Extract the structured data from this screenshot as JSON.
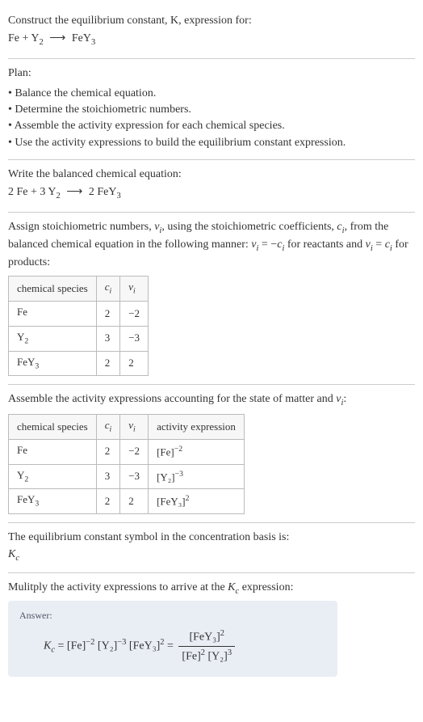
{
  "intro": {
    "line1": "Construct the equilibrium constant, K, expression for:",
    "reaction_lhs_a": "Fe",
    "plus": "+",
    "reaction_lhs_b": "Y",
    "reaction_lhs_b_sub": "2",
    "arrow": "⟶",
    "reaction_rhs": "FeY",
    "reaction_rhs_sub": "3"
  },
  "plan": {
    "heading": "Plan:",
    "items": [
      "Balance the chemical equation.",
      "Determine the stoichiometric numbers.",
      "Assemble the activity expression for each chemical species.",
      "Use the activity expressions to build the equilibrium constant expression."
    ]
  },
  "balanced": {
    "heading": "Write the balanced chemical equation:",
    "c1": "2",
    "sp1": "Fe",
    "plus1": "+",
    "c2": "3",
    "sp2": "Y",
    "sp2_sub": "2",
    "arrow": "⟶",
    "c3": "2",
    "sp3": "FeY",
    "sp3_sub": "3"
  },
  "assign": {
    "text_a": "Assign stoichiometric numbers, ",
    "nu": "ν",
    "nu_sub": "i",
    "text_b": ", using the stoichiometric coefficients, ",
    "ci": "c",
    "ci_sub": "i",
    "text_c": ", from the balanced chemical equation in the following manner: ",
    "rel1_a": "ν",
    "rel1_asub": "i",
    "rel1_eq": " = −",
    "rel1_b": "c",
    "rel1_bsub": "i",
    "text_d": " for reactants and ",
    "rel2_a": "ν",
    "rel2_asub": "i",
    "rel2_eq": " = ",
    "rel2_b": "c",
    "rel2_bsub": "i",
    "text_e": " for products:"
  },
  "table1": {
    "h1": "chemical species",
    "h2c": "c",
    "h2s": "i",
    "h3c": "ν",
    "h3s": "i",
    "rows": [
      {
        "sp": "Fe",
        "spsub": "",
        "c": "2",
        "v": "−2"
      },
      {
        "sp": "Y",
        "spsub": "2",
        "c": "3",
        "v": "−3"
      },
      {
        "sp": "FeY",
        "spsub": "3",
        "c": "2",
        "v": "2"
      }
    ]
  },
  "assemble": {
    "text_a": "Assemble the activity expressions accounting for the state of matter and ",
    "nu": "ν",
    "nu_sub": "i",
    "text_b": ":"
  },
  "table2": {
    "h1": "chemical species",
    "h2c": "c",
    "h2s": "i",
    "h3c": "ν",
    "h3s": "i",
    "h4": "activity expression",
    "rows": [
      {
        "sp": "Fe",
        "spsub": "",
        "c": "2",
        "v": "−2",
        "act": "[Fe]",
        "exp": "−2"
      },
      {
        "sp": "Y",
        "spsub": "2",
        "c": "3",
        "v": "−3",
        "act": "[Y₂]",
        "exp": "−3"
      },
      {
        "sp": "FeY",
        "spsub": "3",
        "c": "2",
        "v": "2",
        "act": "[FeY₃]",
        "exp": "2"
      }
    ]
  },
  "symbol": {
    "text": "The equilibrium constant symbol in the concentration basis is:",
    "k": "K",
    "ksub": "c"
  },
  "multiply": {
    "text_a": "Mulitply the activity expressions to arrive at the ",
    "k": "K",
    "ksub": "c",
    "text_b": " expression:"
  },
  "answer": {
    "label": "Answer:",
    "k": "K",
    "ksub": "c",
    "eq": " = ",
    "t1": "[Fe]",
    "e1": "−2",
    "t2": " [Y₂]",
    "e2": "−3",
    "t3": " [FeY₃]",
    "e3": "2",
    "eq2": " = ",
    "num": "[FeY₃]",
    "num_exp": "2",
    "den_a": "[Fe]",
    "den_a_exp": "2",
    "den_b": " [Y₂]",
    "den_b_exp": "3"
  },
  "chart_data": {
    "type": "table",
    "tables": [
      {
        "columns": [
          "chemical species",
          "c_i",
          "ν_i"
        ],
        "rows": [
          [
            "Fe",
            2,
            -2
          ],
          [
            "Y2",
            3,
            -3
          ],
          [
            "FeY3",
            2,
            2
          ]
        ]
      },
      {
        "columns": [
          "chemical species",
          "c_i",
          "ν_i",
          "activity expression"
        ],
        "rows": [
          [
            "Fe",
            2,
            -2,
            "[Fe]^-2"
          ],
          [
            "Y2",
            3,
            -3,
            "[Y2]^-3"
          ],
          [
            "FeY3",
            2,
            2,
            "[FeY3]^2"
          ]
        ]
      }
    ]
  }
}
